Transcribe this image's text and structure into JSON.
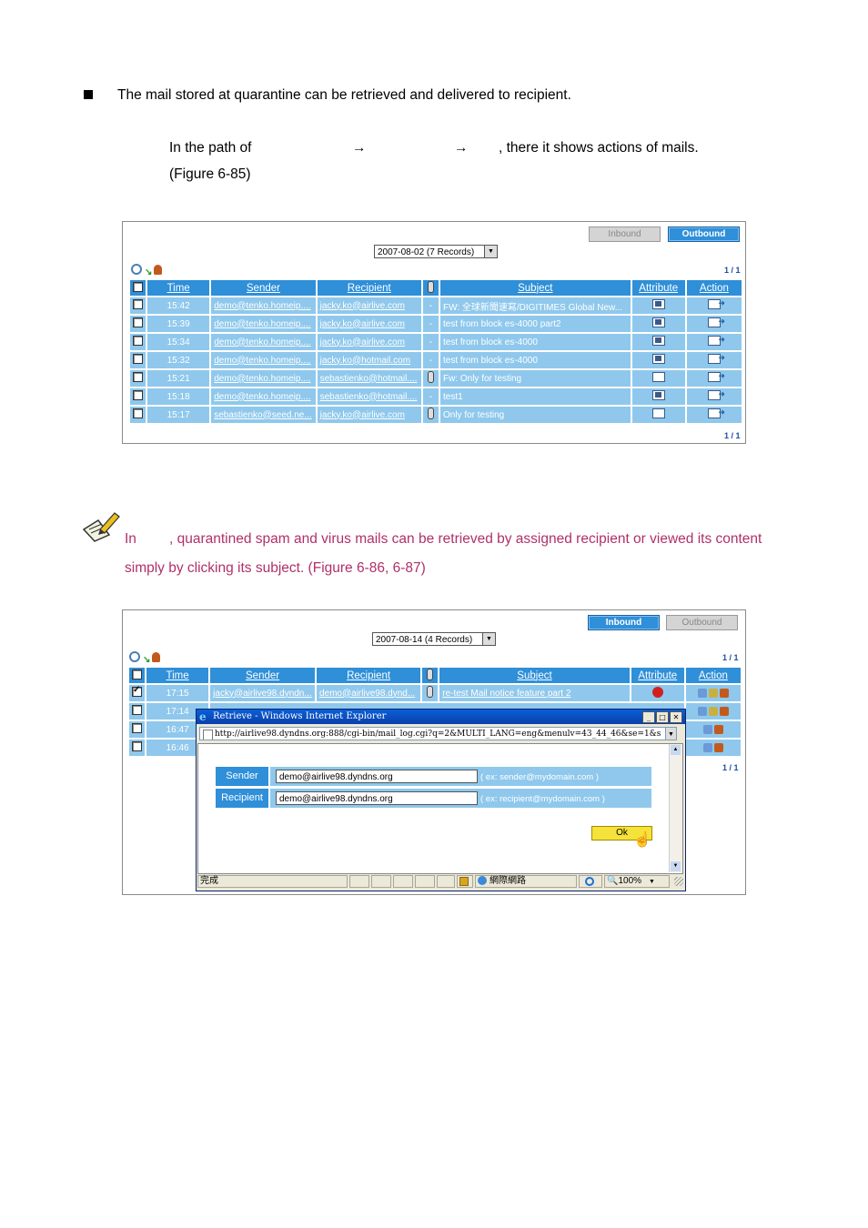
{
  "intro": {
    "bullet_text": "The mail stored at quarantine can be retrieved and delivered to recipient.",
    "path_prefix": "In the path of",
    "path_arrow": "→",
    "path_suffix": ", there it shows actions of mails.",
    "figure_ref": "(Figure 6-85)"
  },
  "figure1": {
    "tabs": {
      "inbound": "Inbound",
      "outbound": "Outbound",
      "active": "outbound"
    },
    "date_select": "2007-08-02 (7 Records)",
    "pager": "1 / 1",
    "headers": {
      "time": "Time",
      "sender": "Sender",
      "recipient": "Recipient",
      "subject": "Subject",
      "attribute": "Attribute",
      "action": "Action"
    },
    "rows": [
      {
        "time": "15:42",
        "sender": "demo@tenko.homeip....",
        "recipient": "jacky.ko@airlive.com",
        "attach": "-",
        "subject": "FW: 全球新聞速寫/DIGITIMES Global New...",
        "attribute": "spam-icon"
      },
      {
        "time": "15:39",
        "sender": "demo@tenko.homeip....",
        "recipient": "jacky.ko@airlive.com",
        "attach": "-",
        "subject": "test from block es-4000 part2",
        "attribute": "spam-icon"
      },
      {
        "time": "15:34",
        "sender": "demo@tenko.homeip....",
        "recipient": "jacky.ko@airlive.com",
        "attach": "-",
        "subject": "test from block es-4000",
        "attribute": "spam-icon"
      },
      {
        "time": "15:32",
        "sender": "demo@tenko.homeip....",
        "recipient": "jacky.ko@hotmail.com",
        "attach": "-",
        "subject": "test from block es-4000",
        "attribute": "spam-icon"
      },
      {
        "time": "15:21",
        "sender": "demo@tenko.homeip....",
        "recipient": "sebastienko@hotmail....",
        "attach": "clip",
        "subject": "Fw: Only for testing",
        "attribute": "mail-icon"
      },
      {
        "time": "15:18",
        "sender": "demo@tenko.homeip....",
        "recipient": "sebastienko@hotmail....",
        "attach": "-",
        "subject": "test1",
        "attribute": "spam-icon"
      },
      {
        "time": "15:17",
        "sender": "sebastienko@seed.ne...",
        "recipient": "jacky.ko@airlive.com",
        "attach": "clip",
        "subject": "Only for testing",
        "attribute": "mail-icon"
      }
    ]
  },
  "note": {
    "prefix": "In",
    "line1": ", quarantined spam and virus mails can be retrieved by assigned recipient or viewed its content",
    "line2": "simply by clicking its subject. (Figure 6-86, 6-87)"
  },
  "figure2": {
    "tabs": {
      "inbound": "Inbound",
      "outbound": "Outbound",
      "active": "inbound"
    },
    "date_select": "2007-08-14 (4 Records)",
    "pager": "1 / 1",
    "headers": {
      "time": "Time",
      "sender": "Sender",
      "recipient": "Recipient",
      "subject": "Subject",
      "attribute": "Attribute",
      "action": "Action"
    },
    "rows": [
      {
        "time": "17:15",
        "sender": "jacky@airlive98.dyndn...",
        "recipient": "demo@airlive98.dynd...",
        "subject": "re-test Mail notice feature part 2",
        "checked": true
      },
      {
        "time": "17:14"
      },
      {
        "time": "16:47"
      },
      {
        "time": "16:46"
      }
    ],
    "popup": {
      "title": "Retrieve - Windows Internet Explorer",
      "address": "http://airlive98.dyndns.org:888/cgi-bin/mail_log.cgi?q=2&MULTI_LANG=eng&menulv=43_44_46&se=1&s",
      "sender_label": "Sender",
      "sender_value": "demo@airlive98.dyndns.org",
      "sender_hint": "( ex: sender@mydomain.com )",
      "recipient_label": "Recipient",
      "recipient_value": "demo@airlive98.dyndns.org",
      "recipient_hint": "( ex: recipient@mydomain.com )",
      "ok_label": "Ok",
      "status_done": "完成",
      "status_zone": "網際網路",
      "status_zoom": "100%"
    }
  }
}
